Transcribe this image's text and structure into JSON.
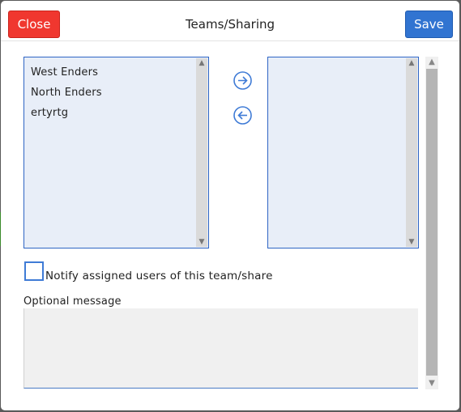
{
  "dialog": {
    "title": "Teams/Sharing",
    "close_label": "Close",
    "save_label": "Save"
  },
  "available_list": {
    "items": [
      "West Enders",
      "North Enders",
      "ertyrtg"
    ]
  },
  "assigned_list": {
    "items": []
  },
  "controls": {
    "add_icon": "arrow-right-circle-icon",
    "remove_icon": "arrow-left-circle-icon"
  },
  "notify": {
    "label": "Notify assigned users of this team/share",
    "checked": false
  },
  "message": {
    "label": "Optional message",
    "value": ""
  },
  "colors": {
    "close_button": "#f0372f",
    "save_button": "#3174d1",
    "list_background": "#e8eef8",
    "list_border": "#2f65c4"
  }
}
